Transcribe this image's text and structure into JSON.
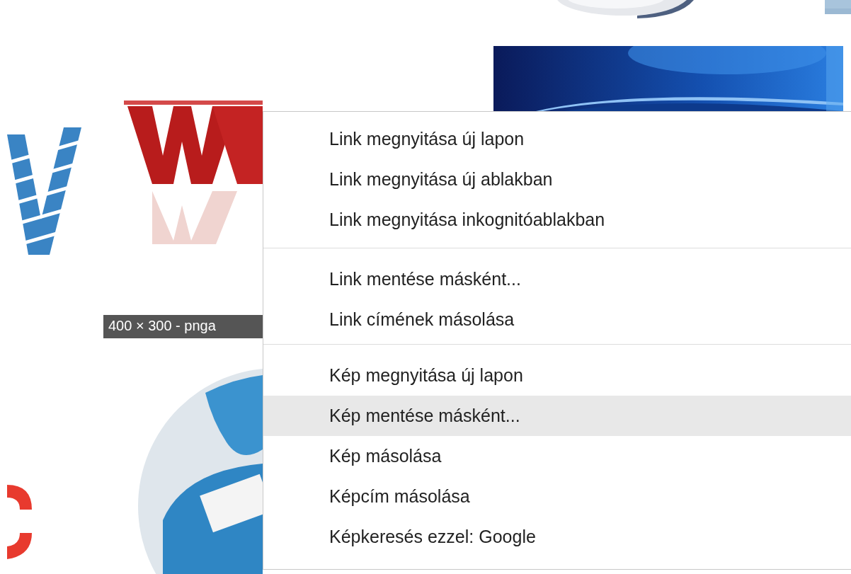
{
  "image_caption": "400 × 300 - pnga",
  "context_menu": {
    "groups": [
      {
        "items": [
          {
            "label": "Link megnyitása új lapon",
            "selected": false
          },
          {
            "label": "Link megnyitása új ablakban",
            "selected": false
          },
          {
            "label": "Link megnyitása inkognitóablakban",
            "selected": false
          }
        ]
      },
      {
        "items": [
          {
            "label": "Link mentése másként...",
            "selected": false
          },
          {
            "label": "Link címének másolása",
            "selected": false
          }
        ]
      },
      {
        "items": [
          {
            "label": "Kép megnyitása új lapon",
            "selected": false
          },
          {
            "label": "Kép mentése másként...",
            "selected": true
          },
          {
            "label": "Kép másolása",
            "selected": false
          },
          {
            "label": "Képcím másolása",
            "selected": false
          },
          {
            "label": "Képkeresés ezzel: Google",
            "selected": false
          }
        ]
      }
    ]
  }
}
